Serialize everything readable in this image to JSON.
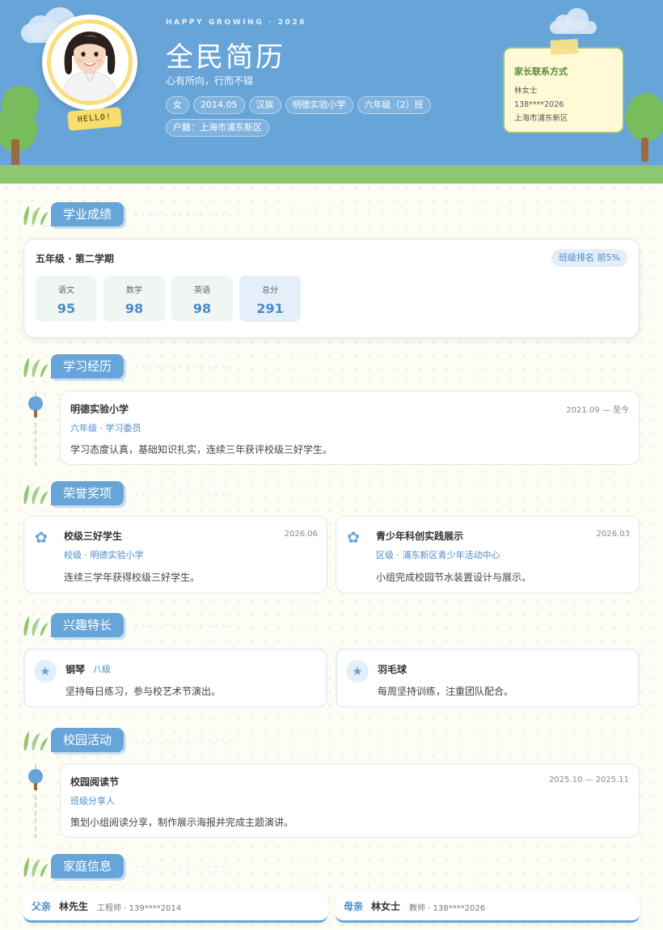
{
  "header": {
    "tagline": "HAPPY GROWING · 2026",
    "name": "全民简历",
    "motto": "心有所向，行而不辍",
    "hello": "HELLO!",
    "chips": [
      "女",
      "2014.05",
      "汉族",
      "明德实验小学",
      "六年级（2）班",
      "户籍：上海市浦东新区"
    ],
    "contact": {
      "title": "家长联系方式",
      "lines": [
        "林女士",
        "138****2026",
        "上海市浦东新区"
      ]
    }
  },
  "sections": {
    "academics": "学业成绩",
    "education": "学习经历",
    "honors": "荣誉奖项",
    "hobbies": "兴趣特长",
    "activities": "校园活动",
    "family": "家庭信息"
  },
  "academics": {
    "term": "五年级 · 第二学期",
    "rank": "班级排名 前5%",
    "scores": [
      {
        "label": "语文",
        "value": "95"
      },
      {
        "label": "数学",
        "value": "98"
      },
      {
        "label": "英语",
        "value": "98"
      },
      {
        "label": "总分",
        "value": "291"
      }
    ]
  },
  "education": [
    {
      "title": "明德实验小学",
      "date": "2021.09 — 至今",
      "role": "六年级 · 学习委员",
      "desc": "学习态度认真，基础知识扎实，连续三年获评校级三好学生。"
    }
  ],
  "honors": [
    {
      "title": "校级三好学生",
      "date": "2026.06",
      "level": "校级 · 明德实验小学",
      "desc": "连续三学年获得校级三好学生。"
    },
    {
      "title": "青少年科创实践展示",
      "date": "2026.03",
      "level": "区级 · 浦东新区青少年活动中心",
      "desc": "小组完成校园节水装置设计与展示。"
    }
  ],
  "hobbies": [
    {
      "title": "钢琴",
      "level": "八级",
      "desc": "坚持每日练习，参与校艺术节演出。"
    },
    {
      "title": "羽毛球",
      "level": "",
      "desc": "每周坚持训练，注重团队配合。"
    }
  ],
  "activities": [
    {
      "title": "校园阅读节",
      "date": "2025.10 — 2025.11",
      "role": "班级分享人",
      "desc": "策划小组阅读分享，制作展示海报并完成主题演讲。"
    }
  ],
  "family": [
    {
      "relation": "父亲",
      "name": "林先生",
      "info": "工程师 · 139****2014"
    },
    {
      "relation": "母亲",
      "name": "林女士",
      "info": "教师 · 138****2026"
    }
  ],
  "colors": {
    "primary": "#67a5d9",
    "grass": "#8fc672",
    "accent": "#f8dc6e"
  },
  "icons": {
    "honor": "flower-icon",
    "hobby": "star-icon",
    "section": "leaf-icon"
  }
}
